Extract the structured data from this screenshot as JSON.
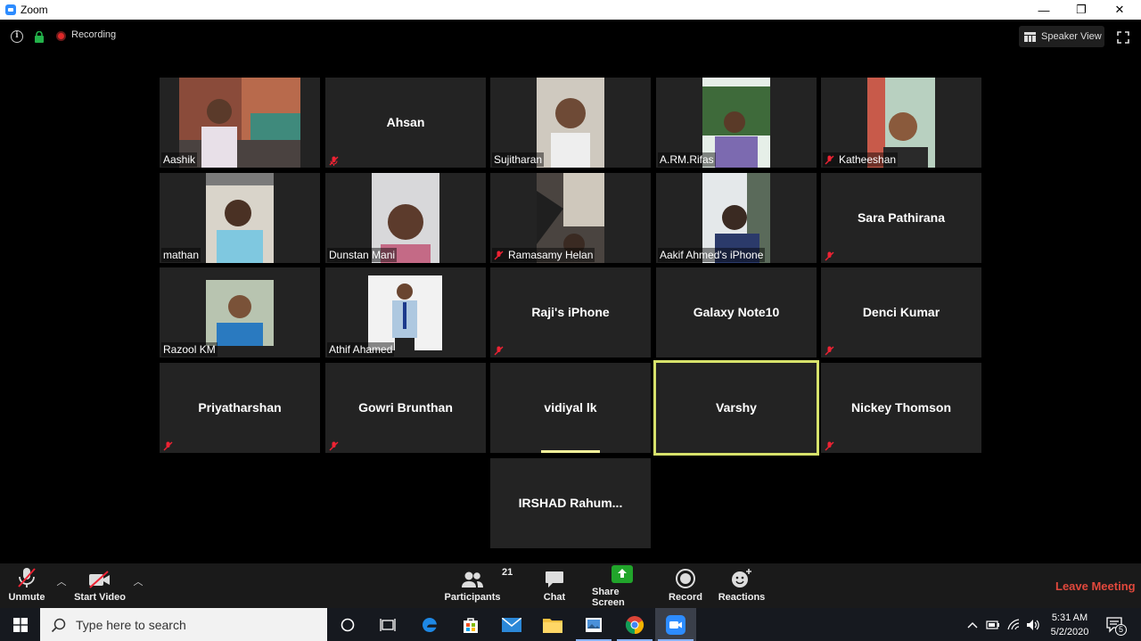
{
  "window": {
    "title": "Zoom",
    "minimize": "—",
    "restore": "❐",
    "close": "✕"
  },
  "topbar": {
    "recording_label": "Recording",
    "speaker_view_label": "Speaker View"
  },
  "tiles": {
    "aashik": "Aashik",
    "ahsan": "Ahsan",
    "sujitharan": "Sujitharan",
    "armrifas": "A.RM.Rifas",
    "katheeshan": "Katheeshan",
    "mathan": "mathan",
    "dunstan": "Dunstan Mani",
    "ramasamy": "Ramasamy Helan",
    "aakif": "Aakif Ahmed's iPhone",
    "sara": "Sara Pathirana",
    "razool": "Razool KM",
    "athif": "Athif Ahamed",
    "raji": "Raji's iPhone",
    "galaxy": "Galaxy Note10",
    "denci": "Denci Kumar",
    "priya": "Priyatharshan",
    "gowri": "Gowri Brunthan",
    "vidiyal": "vidiyal lk",
    "varshy": "Varshy",
    "nickey": "Nickey Thomson",
    "irshad": "IRSHAD  Rahum..."
  },
  "toolbar": {
    "unmute": "Unmute",
    "start_video": "Start Video",
    "participants": "Participants",
    "participants_count": "21",
    "chat": "Chat",
    "share_screen": "Share Screen",
    "record": "Record",
    "reactions": "Reactions",
    "leave": "Leave Meeting"
  },
  "taskbar": {
    "search_placeholder": "Type here to search",
    "time": "5:31 AM",
    "date": "5/2/2020",
    "notification_count": "5"
  },
  "colors": {
    "active_speaker_border": "#d7e26b",
    "leave_red": "#e0483c",
    "share_green": "#21a52b",
    "tile_bg": "#232323"
  }
}
